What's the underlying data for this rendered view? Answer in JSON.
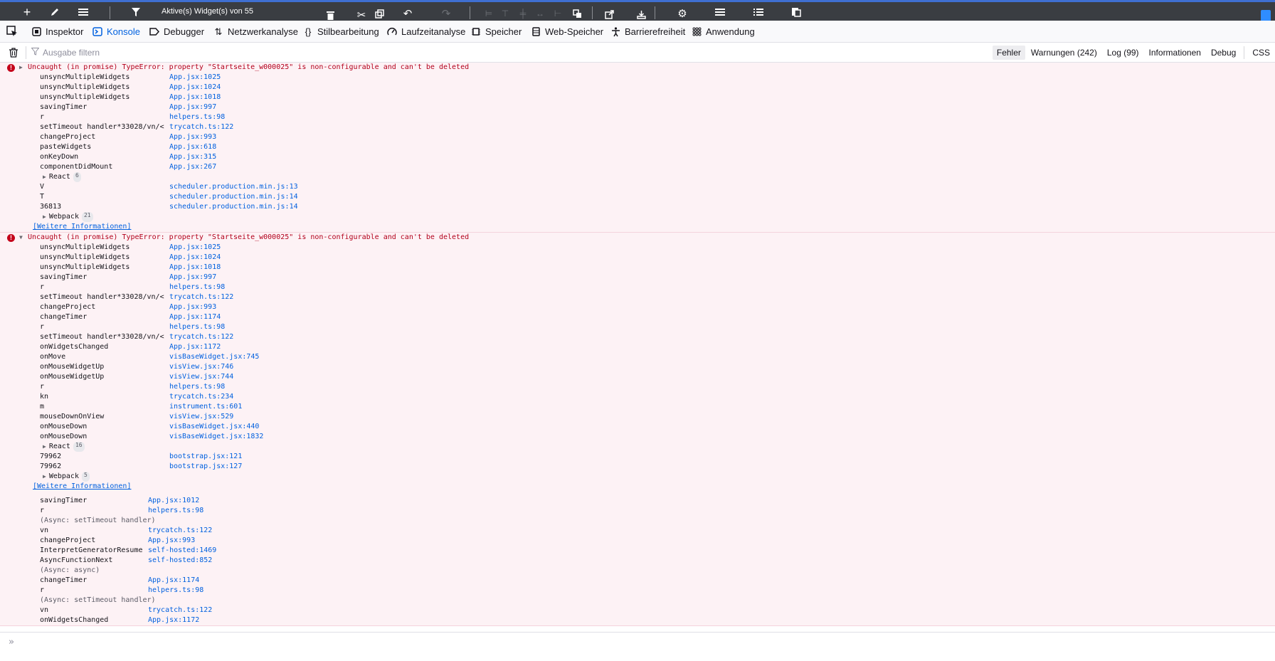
{
  "app_toolbar": {
    "title": "Aktive(s) Widget(s) von 55"
  },
  "devtools_tabs": [
    {
      "label": "Inspektor",
      "icon": "inspector-icon"
    },
    {
      "label": "Konsole",
      "icon": "console-icon",
      "active": true
    },
    {
      "label": "Debugger",
      "icon": "debugger-icon"
    },
    {
      "label": "Netzwerkanalyse",
      "icon": "network-icon"
    },
    {
      "label": "Stilbearbeitung",
      "icon": "style-editor-icon"
    },
    {
      "label": "Laufzeitanalyse",
      "icon": "performance-icon"
    },
    {
      "label": "Speicher",
      "icon": "memory-icon"
    },
    {
      "label": "Web-Speicher",
      "icon": "storage-icon"
    },
    {
      "label": "Barrierefreiheit",
      "icon": "accessibility-icon"
    },
    {
      "label": "Anwendung",
      "icon": "application-icon"
    }
  ],
  "filter": {
    "placeholder": "Ausgabe filtern",
    "levels": [
      "Fehler",
      "Warnungen (242)",
      "Log (99)",
      "Informationen",
      "Debug"
    ],
    "css_label": "CSS"
  },
  "messages": [
    {
      "text": "Uncaught (in promise) TypeError: property \"Startseite_w000025\" is non-configurable and can't be deleted",
      "frames": [
        {
          "fn": "unsyncMultipleWidgets",
          "loc": "App.jsx:1025"
        },
        {
          "fn": "unsyncMultipleWidgets",
          "loc": "App.jsx:1024"
        },
        {
          "fn": "unsyncMultipleWidgets",
          "loc": "App.jsx:1018"
        },
        {
          "fn": "savingTimer",
          "loc": "App.jsx:997"
        },
        {
          "fn": "r",
          "loc": "helpers.ts:98"
        },
        {
          "fn": "setTimeout handler*33028/vn/<",
          "loc": "trycatch.ts:122"
        },
        {
          "fn": "changeProject",
          "loc": "App.jsx:993"
        },
        {
          "fn": "pasteWidgets",
          "loc": "App.jsx:618"
        },
        {
          "fn": "onKeyDown",
          "loc": "App.jsx:315"
        },
        {
          "fn": "componentDidMount",
          "loc": "App.jsx:267"
        },
        {
          "group": "React",
          "count": "6"
        },
        {
          "fn": "V",
          "loc": "scheduler.production.min.js:13"
        },
        {
          "fn": "T",
          "loc": "scheduler.production.min.js:14"
        },
        {
          "fn": "36813",
          "loc": "scheduler.production.min.js:14"
        },
        {
          "group": "Webpack",
          "count": "21"
        }
      ],
      "more": "[Weitere Informationen]"
    },
    {
      "text": "Uncaught (in promise) TypeError: property \"Startseite_w000025\" is non-configurable and can't be deleted",
      "frames": [
        {
          "fn": "unsyncMultipleWidgets",
          "loc": "App.jsx:1025"
        },
        {
          "fn": "unsyncMultipleWidgets",
          "loc": "App.jsx:1024"
        },
        {
          "fn": "unsyncMultipleWidgets",
          "loc": "App.jsx:1018"
        },
        {
          "fn": "savingTimer",
          "loc": "App.jsx:997"
        },
        {
          "fn": "r",
          "loc": "helpers.ts:98"
        },
        {
          "fn": "setTimeout handler*33028/vn/<",
          "loc": "trycatch.ts:122"
        },
        {
          "fn": "changeProject",
          "loc": "App.jsx:993"
        },
        {
          "fn": "changeTimer",
          "loc": "App.jsx:1174"
        },
        {
          "fn": "r",
          "loc": "helpers.ts:98"
        },
        {
          "fn": "setTimeout handler*33028/vn/<",
          "loc": "trycatch.ts:122"
        },
        {
          "fn": "onWidgetsChanged",
          "loc": "App.jsx:1172"
        },
        {
          "fn": "onMove",
          "loc": "visBaseWidget.jsx:745"
        },
        {
          "fn": "onMouseWidgetUp",
          "loc": "visView.jsx:746"
        },
        {
          "fn": "onMouseWidgetUp",
          "loc": "visView.jsx:744"
        },
        {
          "fn": "r",
          "loc": "helpers.ts:98"
        },
        {
          "fn": "kn",
          "loc": "trycatch.ts:234"
        },
        {
          "fn": "m",
          "loc": "instrument.ts:601"
        },
        {
          "fn": "mouseDownOnView",
          "loc": "visView.jsx:529"
        },
        {
          "fn": "onMouseDown",
          "loc": "visBaseWidget.jsx:440"
        },
        {
          "fn": "onMouseDown",
          "loc": "visBaseWidget.jsx:1832"
        },
        {
          "group": "React",
          "count": "16"
        },
        {
          "fn": "79962",
          "loc": "bootstrap.jsx:121"
        },
        {
          "fn": "79962",
          "loc": "bootstrap.jsx:127"
        },
        {
          "group": "Webpack",
          "count": "5"
        }
      ],
      "more": "[Weitere Informationen]",
      "async_frames": [
        {
          "fn": "savingTimer",
          "loc": "App.jsx:1012"
        },
        {
          "fn": "r",
          "loc": "helpers.ts:98"
        },
        {
          "async": "(Async: setTimeout handler)"
        },
        {
          "fn": "vn",
          "loc": "trycatch.ts:122"
        },
        {
          "fn": "changeProject",
          "loc": "App.jsx:993"
        },
        {
          "fn": "InterpretGeneratorResume",
          "loc": "self-hosted:1469"
        },
        {
          "fn": "AsyncFunctionNext",
          "loc": "self-hosted:852"
        },
        {
          "async": "(Async: async)"
        },
        {
          "fn": "changeTimer",
          "loc": "App.jsx:1174"
        },
        {
          "fn": "r",
          "loc": "helpers.ts:98"
        },
        {
          "async": "(Async: setTimeout handler)"
        },
        {
          "fn": "vn",
          "loc": "trycatch.ts:122"
        },
        {
          "fn": "onWidgetsChanged",
          "loc": "App.jsx:1172"
        }
      ]
    }
  ],
  "colors": {
    "error_text": "#b3001b",
    "error_bg": "#fdf2f5",
    "link": "#0060df",
    "active_tab": "#0061e0",
    "toolbar_bg": "#3a3d42",
    "toolbar_accent": "#3f6fd1"
  },
  "input": {
    "prompt": "»"
  }
}
